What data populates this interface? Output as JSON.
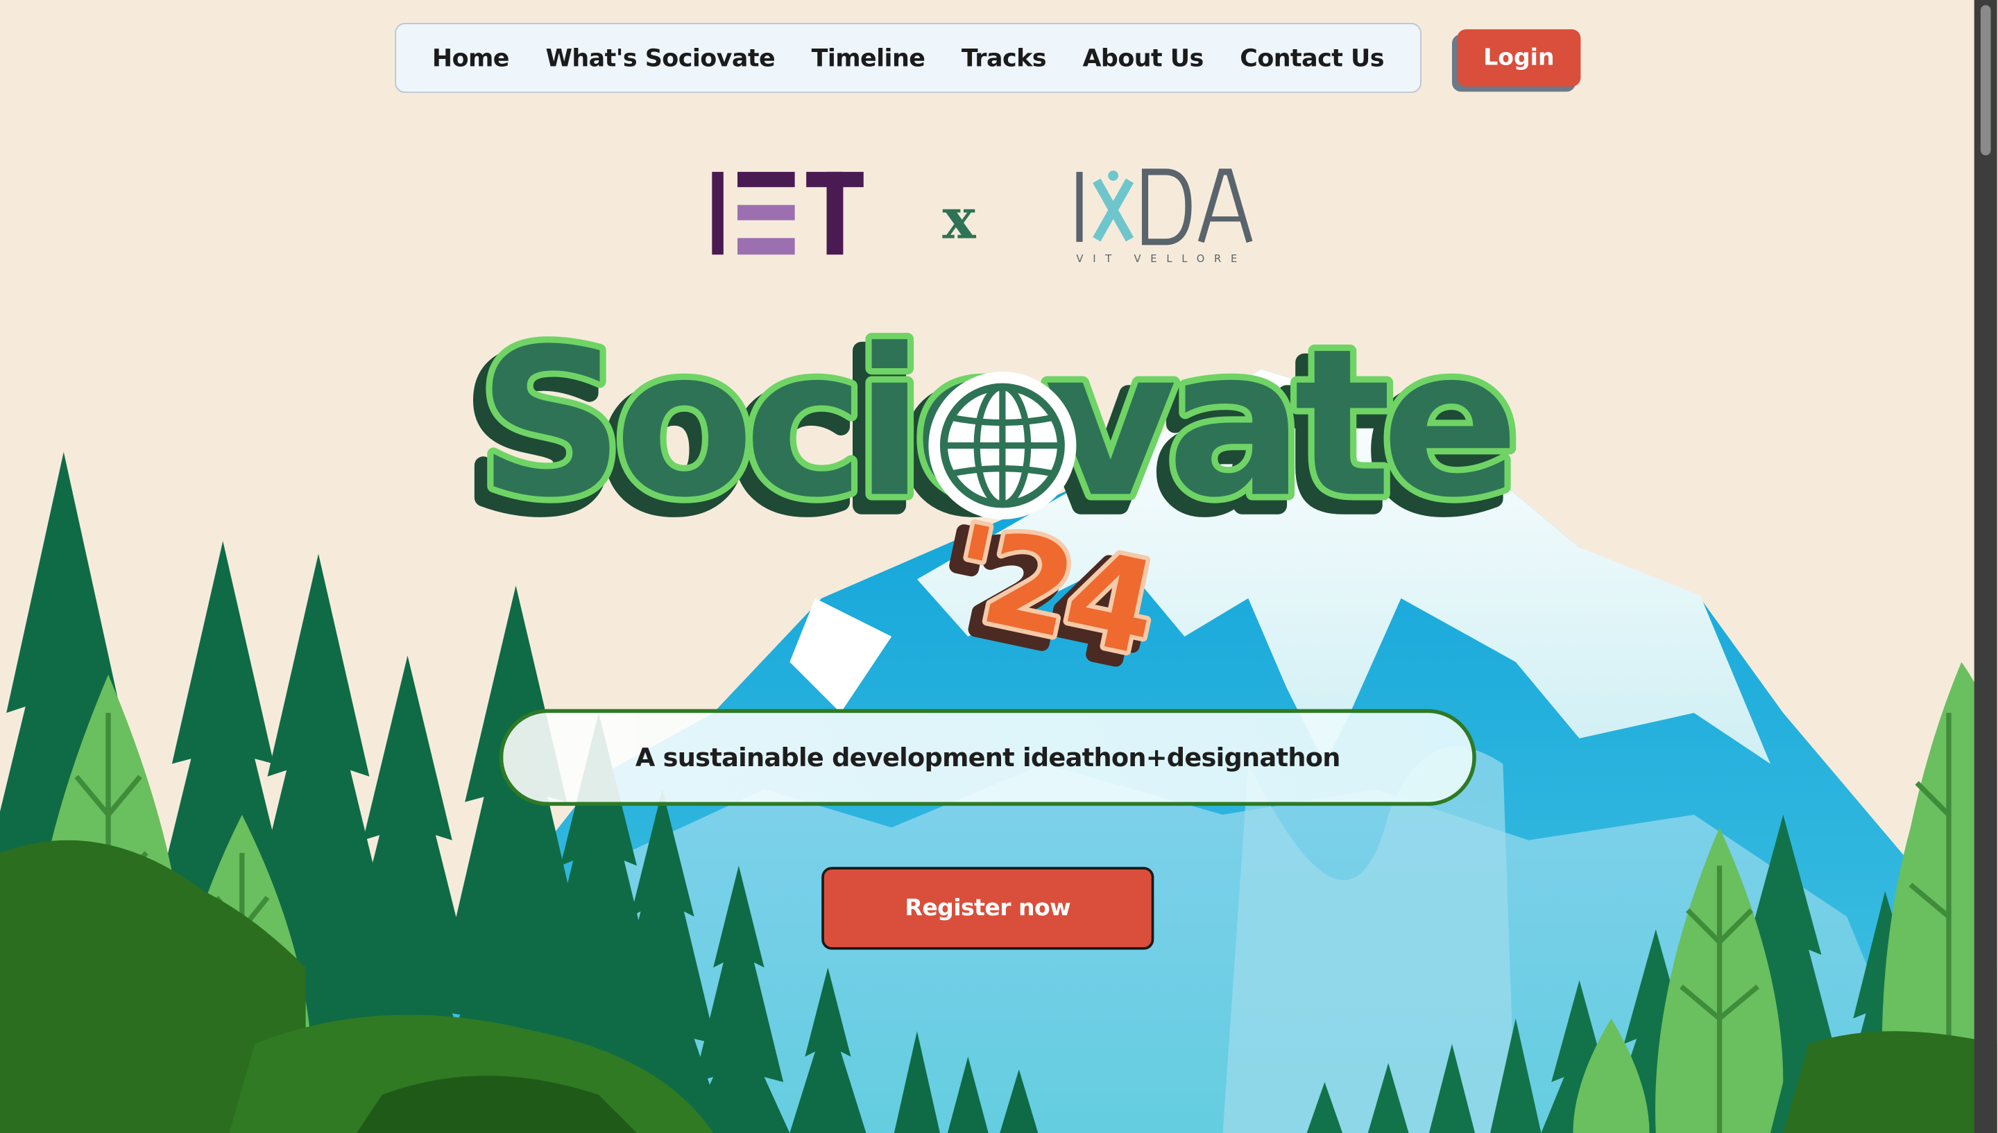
{
  "nav": {
    "items": [
      {
        "label": "Home"
      },
      {
        "label": "What's Sociovate"
      },
      {
        "label": "Timeline"
      },
      {
        "label": "Tracks"
      },
      {
        "label": "About Us"
      },
      {
        "label": "Contact Us"
      }
    ],
    "login_label": "Login"
  },
  "logos": {
    "left": "IET",
    "separator": "x",
    "right": "IXDA",
    "right_subtitle": "VIT VELLORE"
  },
  "hero": {
    "title": "Sociovate",
    "year": "'24",
    "tagline": "A sustainable development ideathon+designathon",
    "register_label": "Register now"
  },
  "colors": {
    "background": "#f6ebdb",
    "accent_red": "#d94f3b",
    "wordmark_green": "#2e7356",
    "wordmark_outline": "#6fd465",
    "year_orange": "#ee6a2e",
    "iet_purple": "#4a1b53",
    "ixda_grey": "#59646c",
    "ixda_teal": "#6ec6cc"
  },
  "icons": [
    "globe-icon",
    "pine-tree-icon",
    "mountain-icon"
  ]
}
